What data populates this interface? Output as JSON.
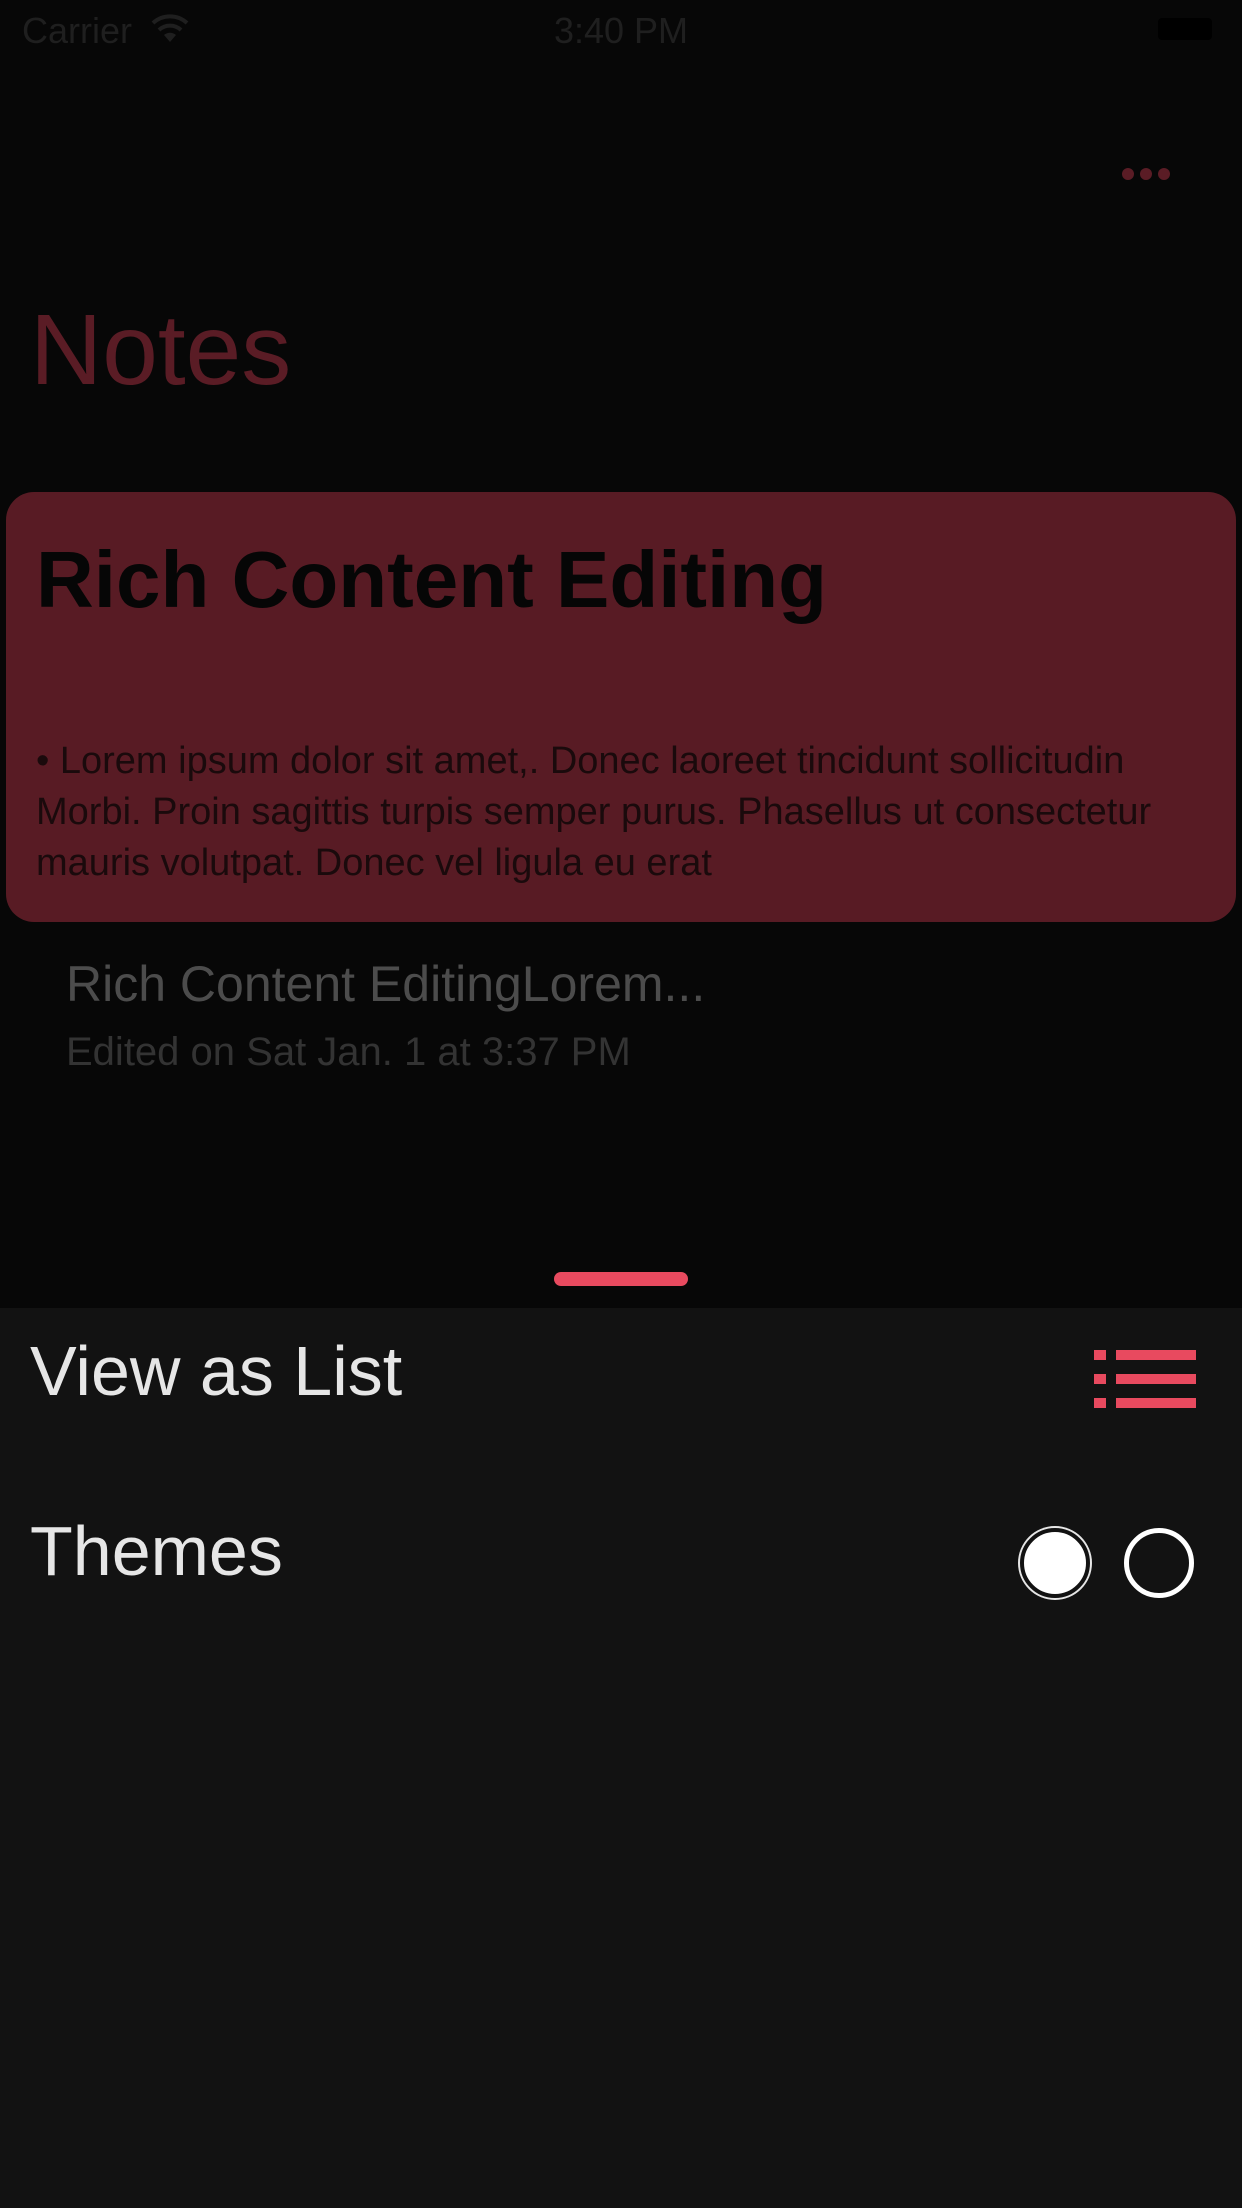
{
  "status_bar": {
    "carrier": "Carrier",
    "time": "3:40 PM"
  },
  "header": {
    "title": "Notes",
    "more_icon": "ellipsis-icon"
  },
  "note_card": {
    "title": "Rich Content Editing",
    "body": "• Lorem ipsum dolor sit amet,. Donec laoreet tincidunt sollicitudin Morbi. Proin sagittis turpis semper purus. Phasellus ut consectetur mauris volutpat. Donec vel ligula eu erat"
  },
  "notes_list": [
    {
      "title": "Rich Content EditingLorem...",
      "edited": "Edited on Sat Jan. 1 at 3:37 PM"
    }
  ],
  "sheet": {
    "view_as_list_label": "View as List",
    "view_icon": "list-icon",
    "themes_label": "Themes",
    "themes": [
      "light",
      "dark"
    ]
  },
  "colors": {
    "accent": "#e84a5f",
    "card": "#581b24",
    "sheet_background": "#121212",
    "backdrop": "#070707"
  }
}
